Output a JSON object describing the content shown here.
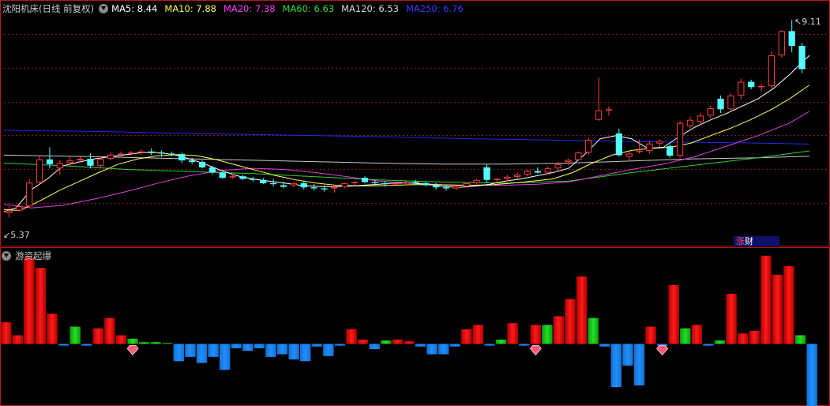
{
  "main_panel": {
    "title": "沈阳机床(日线 前复权)",
    "indicators": [
      {
        "label": "MA5: 8.44",
        "color": "#ffffff"
      },
      {
        "label": "MA10: 7.88",
        "color": "#ffff4a"
      },
      {
        "label": "MA20: 7.38",
        "color": "#ff3cff"
      },
      {
        "label": "MA60: 6.63",
        "color": "#3cdc3c"
      },
      {
        "label": "MA120: 6.53",
        "color": "#d8d8d8"
      },
      {
        "label": "MA250: 6.76",
        "color": "#3c3cff"
      }
    ],
    "high_label": "9.11",
    "low_label": "5.37",
    "badge": {
      "part1": "涨",
      "part2": "财"
    },
    "colors": {
      "up": "#ff3c3c",
      "down": "#54ffff",
      "grid": "#8a1c1c",
      "border": "#b01c1c"
    }
  },
  "sub_panel": {
    "title": "游资起爆",
    "colors": {
      "red": "#ff1a1a",
      "green": "#22e022",
      "blue": "#1f8fff",
      "gem": "#ff5a78"
    }
  },
  "chart_data": {
    "type": "candlestick",
    "y_range": [
      5.0,
      9.4
    ],
    "candles": [
      [
        5.45,
        5.58,
        5.37,
        5.5
      ],
      [
        5.5,
        5.6,
        5.48,
        5.58
      ],
      [
        5.58,
        6.1,
        5.55,
        6.03
      ],
      [
        6.03,
        6.55,
        6.0,
        6.47
      ],
      [
        6.47,
        6.7,
        6.3,
        6.38
      ],
      [
        6.3,
        6.45,
        6.18,
        6.4
      ],
      [
        6.4,
        6.52,
        6.35,
        6.45
      ],
      [
        6.45,
        6.52,
        6.4,
        6.48
      ],
      [
        6.48,
        6.58,
        6.3,
        6.35
      ],
      [
        6.35,
        6.52,
        6.32,
        6.48
      ],
      [
        6.48,
        6.6,
        6.45,
        6.56
      ],
      [
        6.56,
        6.62,
        6.5,
        6.58
      ],
      [
        6.58,
        6.63,
        6.54,
        6.6
      ],
      [
        6.6,
        6.66,
        6.56,
        6.62
      ],
      [
        6.62,
        6.68,
        6.55,
        6.6
      ],
      [
        6.6,
        6.64,
        6.52,
        6.58
      ],
      [
        6.58,
        6.62,
        6.53,
        6.57
      ],
      [
        6.57,
        6.6,
        6.4,
        6.45
      ],
      [
        6.45,
        6.5,
        6.38,
        6.42
      ],
      [
        6.42,
        6.45,
        6.3,
        6.32
      ],
      [
        6.32,
        6.35,
        6.18,
        6.22
      ],
      [
        6.22,
        6.25,
        6.1,
        6.12
      ],
      [
        6.15,
        6.2,
        6.1,
        6.15
      ],
      [
        6.15,
        6.18,
        6.08,
        6.1
      ],
      [
        6.1,
        6.14,
        6.05,
        6.08
      ],
      [
        6.08,
        6.12,
        6.0,
        6.02
      ],
      [
        6.02,
        6.1,
        5.96,
        6.0
      ],
      [
        5.98,
        6.05,
        5.92,
        5.95
      ],
      [
        5.98,
        6.04,
        5.94,
        6.02
      ],
      [
        6.02,
        6.06,
        5.9,
        5.94
      ],
      [
        5.94,
        6.0,
        5.88,
        5.92
      ],
      [
        5.92,
        5.98,
        5.86,
        5.9
      ],
      [
        5.92,
        5.98,
        5.84,
        5.95
      ],
      [
        5.95,
        6.04,
        5.92,
        6.02
      ],
      [
        6.02,
        6.06,
        5.98,
        6.04
      ],
      [
        6.12,
        6.15,
        6.02,
        6.04
      ],
      [
        6.04,
        6.08,
        5.98,
        6.02
      ],
      [
        6.02,
        6.06,
        5.95,
        6.0
      ],
      [
        6.0,
        6.04,
        5.96,
        6.02
      ],
      [
        6.02,
        6.06,
        5.98,
        6.04
      ],
      [
        6.04,
        6.08,
        6.0,
        6.02
      ],
      [
        6.02,
        6.05,
        5.96,
        5.98
      ],
      [
        5.98,
        6.02,
        5.9,
        5.94
      ],
      [
        5.94,
        5.98,
        5.88,
        5.92
      ],
      [
        5.92,
        5.98,
        5.89,
        5.96
      ],
      [
        5.96,
        6.04,
        5.94,
        6.02
      ],
      [
        6.02,
        6.1,
        6.0,
        6.08
      ],
      [
        6.32,
        6.38,
        6.02,
        6.08
      ],
      [
        6.08,
        6.12,
        6.04,
        6.1
      ],
      [
        6.1,
        6.18,
        6.06,
        6.14
      ],
      [
        6.14,
        6.22,
        6.1,
        6.18
      ],
      [
        6.18,
        6.28,
        6.15,
        6.25
      ],
      [
        6.25,
        6.32,
        6.2,
        6.22
      ],
      [
        6.22,
        6.34,
        6.18,
        6.3
      ],
      [
        6.3,
        6.42,
        6.26,
        6.38
      ],
      [
        6.42,
        6.48,
        6.36,
        6.46
      ],
      [
        6.46,
        6.62,
        6.44,
        6.6
      ],
      [
        6.6,
        6.88,
        6.55,
        6.84
      ],
      [
        7.22,
        8.02,
        7.2,
        7.4
      ],
      [
        7.4,
        7.48,
        7.3,
        7.42
      ],
      [
        6.96,
        7.05,
        6.52,
        6.55
      ],
      [
        6.52,
        6.62,
        6.45,
        6.58
      ],
      [
        6.62,
        6.85,
        6.58,
        6.63
      ],
      [
        6.63,
        6.82,
        6.58,
        6.77
      ],
      [
        6.77,
        6.85,
        6.7,
        6.82
      ],
      [
        6.72,
        6.76,
        6.5,
        6.54
      ],
      [
        6.54,
        7.2,
        6.5,
        7.16
      ],
      [
        7.1,
        7.28,
        7.05,
        7.22
      ],
      [
        7.18,
        7.35,
        7.12,
        7.3
      ],
      [
        7.3,
        7.48,
        7.25,
        7.44
      ],
      [
        7.62,
        7.68,
        7.35,
        7.42
      ],
      [
        7.42,
        7.72,
        7.4,
        7.68
      ],
      [
        7.68,
        8.0,
        7.6,
        7.94
      ],
      [
        7.94,
        7.98,
        7.8,
        7.84
      ],
      [
        7.84,
        7.9,
        7.76,
        7.86
      ],
      [
        7.86,
        8.52,
        7.82,
        8.44
      ],
      [
        8.44,
        8.92,
        8.4,
        8.9
      ],
      [
        8.9,
        9.11,
        8.5,
        8.62
      ],
      [
        8.62,
        8.68,
        8.1,
        8.18
      ]
    ],
    "x_range": [
      0,
      1030
    ],
    "ma_lines": {
      "MA5": [
        [
          5,
          5.48
        ],
        [
          20,
          5.55
        ],
        [
          40,
          5.9
        ],
        [
          60,
          6.1
        ],
        [
          80,
          6.35
        ],
        [
          100,
          6.42
        ],
        [
          120,
          6.48
        ],
        [
          140,
          6.52
        ],
        [
          160,
          6.56
        ],
        [
          180,
          6.6
        ],
        [
          200,
          6.6
        ],
        [
          220,
          6.56
        ],
        [
          240,
          6.48
        ],
        [
          260,
          6.38
        ],
        [
          280,
          6.26
        ],
        [
          300,
          6.16
        ],
        [
          320,
          6.1
        ],
        [
          340,
          6.06
        ],
        [
          360,
          6.02
        ],
        [
          380,
          5.98
        ],
        [
          400,
          5.96
        ],
        [
          420,
          5.95
        ],
        [
          440,
          5.96
        ],
        [
          460,
          5.98
        ],
        [
          480,
          6.0
        ],
        [
          500,
          6.02
        ],
        [
          520,
          6.02
        ],
        [
          540,
          6.0
        ],
        [
          560,
          5.96
        ],
        [
          580,
          5.94
        ],
        [
          600,
          5.96
        ],
        [
          620,
          6.0
        ],
        [
          640,
          6.06
        ],
        [
          660,
          6.1
        ],
        [
          680,
          6.16
        ],
        [
          700,
          6.22
        ],
        [
          720,
          6.3
        ],
        [
          740,
          6.56
        ],
        [
          760,
          6.86
        ],
        [
          780,
          6.92
        ],
        [
          800,
          6.86
        ],
        [
          820,
          6.68
        ],
        [
          840,
          6.7
        ],
        [
          860,
          6.9
        ],
        [
          880,
          7.08
        ],
        [
          900,
          7.22
        ],
        [
          920,
          7.34
        ],
        [
          940,
          7.48
        ],
        [
          960,
          7.62
        ],
        [
          980,
          7.82
        ],
        [
          1000,
          8.08
        ],
        [
          1015,
          8.3
        ],
        [
          1025,
          8.44
        ]
      ],
      "MA10": [
        [
          5,
          5.52
        ],
        [
          25,
          5.5
        ],
        [
          50,
          5.68
        ],
        [
          75,
          5.88
        ],
        [
          100,
          6.05
        ],
        [
          125,
          6.22
        ],
        [
          150,
          6.38
        ],
        [
          175,
          6.48
        ],
        [
          200,
          6.54
        ],
        [
          225,
          6.56
        ],
        [
          250,
          6.54
        ],
        [
          275,
          6.46
        ],
        [
          300,
          6.36
        ],
        [
          325,
          6.26
        ],
        [
          350,
          6.16
        ],
        [
          375,
          6.08
        ],
        [
          400,
          6.02
        ],
        [
          425,
          5.98
        ],
        [
          450,
          5.97
        ],
        [
          475,
          5.97
        ],
        [
          500,
          5.98
        ],
        [
          525,
          5.99
        ],
        [
          550,
          5.99
        ],
        [
          575,
          5.98
        ],
        [
          600,
          5.98
        ],
        [
          625,
          5.99
        ],
        [
          650,
          6.02
        ],
        [
          675,
          6.06
        ],
        [
          700,
          6.1
        ],
        [
          725,
          6.22
        ],
        [
          750,
          6.4
        ],
        [
          775,
          6.55
        ],
        [
          800,
          6.64
        ],
        [
          825,
          6.68
        ],
        [
          850,
          6.7
        ],
        [
          875,
          6.78
        ],
        [
          900,
          6.92
        ],
        [
          925,
          7.06
        ],
        [
          950,
          7.22
        ],
        [
          975,
          7.4
        ],
        [
          1000,
          7.62
        ],
        [
          1025,
          7.88
        ]
      ],
      "MA20": [
        [
          5,
          5.62
        ],
        [
          40,
          5.55
        ],
        [
          80,
          5.6
        ],
        [
          120,
          5.72
        ],
        [
          160,
          5.86
        ],
        [
          200,
          6.02
        ],
        [
          240,
          6.16
        ],
        [
          280,
          6.26
        ],
        [
          320,
          6.3
        ],
        [
          360,
          6.28
        ],
        [
          400,
          6.22
        ],
        [
          440,
          6.14
        ],
        [
          480,
          6.06
        ],
        [
          520,
          6.02
        ],
        [
          560,
          5.99
        ],
        [
          600,
          5.98
        ],
        [
          640,
          5.98
        ],
        [
          680,
          6.0
        ],
        [
          720,
          6.04
        ],
        [
          760,
          6.16
        ],
        [
          800,
          6.28
        ],
        [
          840,
          6.38
        ],
        [
          880,
          6.52
        ],
        [
          920,
          6.72
        ],
        [
          960,
          6.92
        ],
        [
          1000,
          7.16
        ],
        [
          1025,
          7.38
        ]
      ],
      "MA60": [
        [
          5,
          6.4
        ],
        [
          80,
          6.35
        ],
        [
          160,
          6.28
        ],
        [
          240,
          6.24
        ],
        [
          320,
          6.2
        ],
        [
          400,
          6.14
        ],
        [
          480,
          6.08
        ],
        [
          560,
          6.04
        ],
        [
          640,
          6.02
        ],
        [
          720,
          6.06
        ],
        [
          800,
          6.22
        ],
        [
          880,
          6.36
        ],
        [
          960,
          6.5
        ],
        [
          1025,
          6.63
        ]
      ],
      "MA120": [
        [
          5,
          6.55
        ],
        [
          120,
          6.52
        ],
        [
          240,
          6.48
        ],
        [
          360,
          6.44
        ],
        [
          480,
          6.4
        ],
        [
          560,
          6.38
        ],
        [
          640,
          6.38
        ],
        [
          720,
          6.4
        ],
        [
          800,
          6.44
        ],
        [
          880,
          6.48
        ],
        [
          960,
          6.5
        ],
        [
          1025,
          6.53
        ]
      ],
      "MA250": [
        [
          5,
          7.02
        ],
        [
          120,
          7.0
        ],
        [
          240,
          6.96
        ],
        [
          360,
          6.93
        ],
        [
          480,
          6.9
        ],
        [
          600,
          6.86
        ],
        [
          720,
          6.83
        ],
        [
          840,
          6.8
        ],
        [
          960,
          6.78
        ],
        [
          1025,
          6.76
        ]
      ]
    },
    "sub_bars": {
      "y_range": [
        -70,
        110
      ],
      "bars": [
        [
          "r",
          25
        ],
        [
          "r",
          10
        ],
        [
          "r",
          100
        ],
        [
          "r",
          88
        ],
        [
          "r",
          35
        ],
        [
          "b",
          -2
        ],
        [
          "g",
          20
        ],
        [
          "b",
          -2
        ],
        [
          "r",
          18
        ],
        [
          "r",
          30
        ],
        [
          "r",
          10
        ],
        [
          "g",
          6
        ],
        [
          "g",
          2
        ],
        [
          "g",
          2
        ],
        [
          "g",
          1
        ],
        [
          "b",
          -20
        ],
        [
          "b",
          -15
        ],
        [
          "b",
          -22
        ],
        [
          "b",
          -15
        ],
        [
          "b",
          -30
        ],
        [
          "b",
          -5
        ],
        [
          "b",
          -8
        ],
        [
          "b",
          -5
        ],
        [
          "b",
          -15
        ],
        [
          "b",
          -12
        ],
        [
          "b",
          -18
        ],
        [
          "b",
          -20
        ],
        [
          "b",
          -3
        ],
        [
          "b",
          -14
        ],
        [
          "b",
          -2
        ],
        [
          "r",
          17
        ],
        [
          "r",
          5
        ],
        [
          "b",
          -6
        ],
        [
          "g",
          4
        ],
        [
          "r",
          5
        ],
        [
          "r",
          3
        ],
        [
          "b",
          -3
        ],
        [
          "b",
          -12
        ],
        [
          "b",
          -12
        ],
        [
          "b",
          -3
        ],
        [
          "r",
          17
        ],
        [
          "r",
          22
        ],
        [
          "b",
          -2
        ],
        [
          "g",
          5
        ],
        [
          "r",
          24
        ],
        [
          "b",
          -2
        ],
        [
          "r",
          22
        ],
        [
          "g",
          22
        ],
        [
          "r",
          32
        ],
        [
          "r",
          52
        ],
        [
          "r",
          78
        ],
        [
          "g",
          30
        ],
        [
          "b",
          -3
        ],
        [
          "b",
          -50
        ],
        [
          "b",
          -25
        ],
        [
          "b",
          -48
        ],
        [
          "r",
          20
        ],
        [
          "b",
          -2
        ],
        [
          "r",
          68
        ],
        [
          "g",
          18
        ],
        [
          "r",
          22
        ],
        [
          "b",
          -2
        ],
        [
          "g",
          4
        ],
        [
          "r",
          58
        ],
        [
          "r",
          12
        ],
        [
          "r",
          15
        ],
        [
          "r",
          102
        ],
        [
          "r",
          80
        ],
        [
          "r",
          90
        ],
        [
          "g",
          10
        ],
        [
          "b",
          -72
        ]
      ],
      "gems": [
        11,
        46,
        57
      ]
    }
  }
}
